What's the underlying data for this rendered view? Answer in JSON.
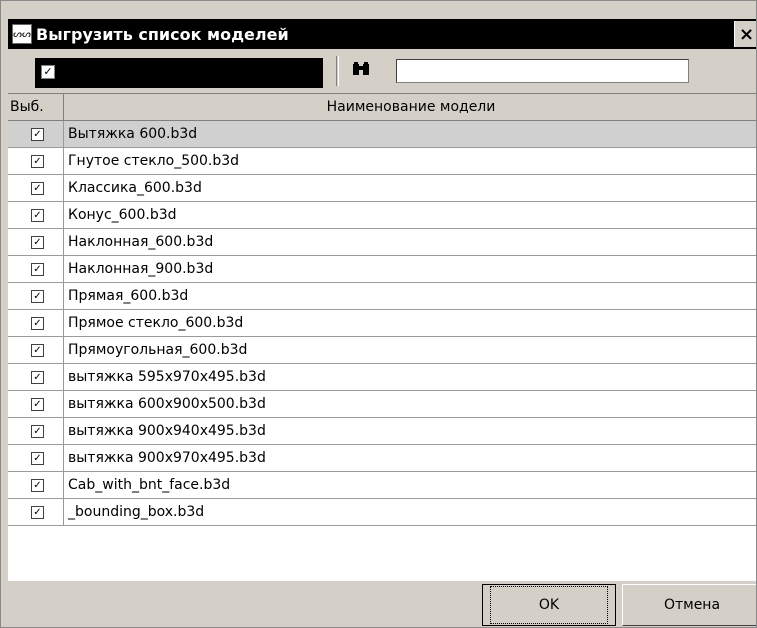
{
  "window": {
    "title": "Выгрузить список моделей",
    "close_glyph": "×",
    "app_icon": "ᔕᔕ"
  },
  "toolbar": {
    "filter_checked": "✓",
    "find_icon": "🔭",
    "search_value": ""
  },
  "table": {
    "columns": [
      "Выб.",
      "Наименование модели"
    ],
    "rows": [
      {
        "checked": "✓",
        "name": "Вытяжка 600.b3d"
      },
      {
        "checked": "✓",
        "name": "Гнутое стекло_500.b3d"
      },
      {
        "checked": "✓",
        "name": "Классика_600.b3d"
      },
      {
        "checked": "✓",
        "name": "Конус_600.b3d"
      },
      {
        "checked": "✓",
        "name": "Наклонная_600.b3d"
      },
      {
        "checked": "✓",
        "name": "Наклонная_900.b3d"
      },
      {
        "checked": "✓",
        "name": "Прямая_600.b3d"
      },
      {
        "checked": "✓",
        "name": "Прямое стекло_600.b3d"
      },
      {
        "checked": "✓",
        "name": "Прямоугольная_600.b3d"
      },
      {
        "checked": "✓",
        "name": "вытяжка 595x970x495.b3d"
      },
      {
        "checked": "✓",
        "name": "вытяжка 600x900x500.b3d"
      },
      {
        "checked": "✓",
        "name": "вытяжка 900x940x495.b3d"
      },
      {
        "checked": "✓",
        "name": "вытяжка 900x970x495.b3d"
      },
      {
        "checked": "✓",
        "name": "Cab_with_bnt_face.b3d"
      },
      {
        "checked": "✓",
        "name": "_bounding_box.b3d"
      }
    ]
  },
  "footer": {
    "ok_label": "OK",
    "cancel_label": "Отмена"
  }
}
